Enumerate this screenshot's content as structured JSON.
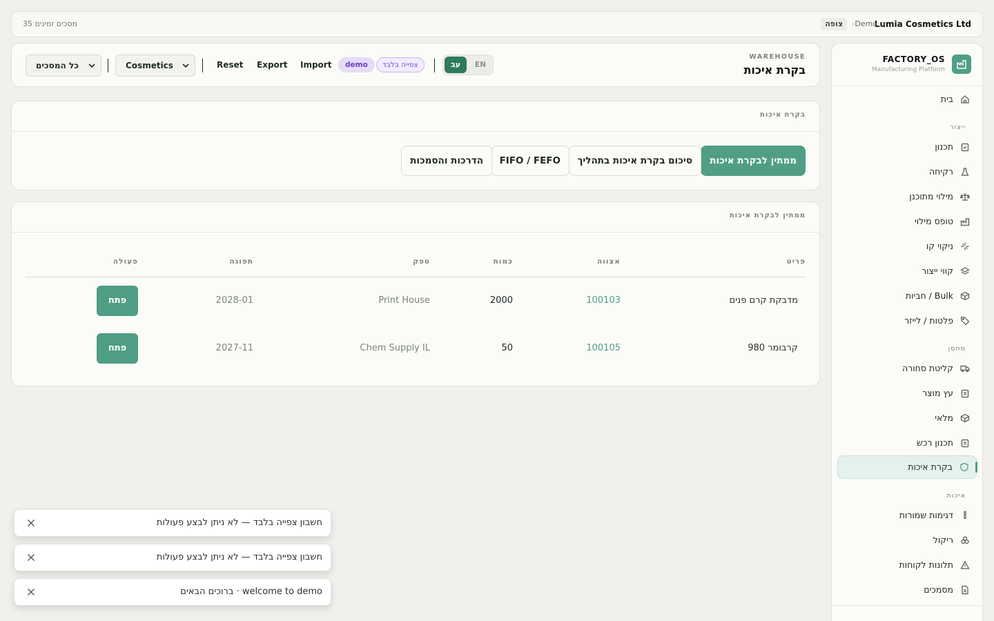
{
  "topbar": {
    "company": "Lumia Cosmetics Ltd",
    "demo": "Demo",
    "mode_badge": "צופה",
    "sessions": "35 מסכים זמינים"
  },
  "sidebar": {
    "brand_title": "FACTORY_OS",
    "brand_subtitle": "Manufacturing Platform",
    "home": "בית",
    "sections": {
      "production": "ייצור",
      "warehouse": "מחסן",
      "quality": "איכות"
    },
    "production_items": [
      "תכנון",
      "רקיחה",
      "מילוי מתוכנן",
      "טופס מילוי",
      "ניקוי קו",
      "קווי ייצור",
      "Bulk / חביות",
      "פלטות / לייזר"
    ],
    "warehouse_items": [
      "קליטת סחורה",
      "עץ מוצר",
      "מלאי",
      "תכנון רכש",
      "בקרת איכות"
    ],
    "quality_items": [
      "דגימות שמורות",
      "ריקול",
      "תלונות לקוחות",
      "מסמכים"
    ]
  },
  "header": {
    "kicker": "WAREHOUSE",
    "title": "בקרת איכות",
    "lang_en": "EN",
    "lang_he": "עב",
    "view_only": "צפייה בלבד",
    "demo": "demo",
    "import": "Import",
    "export": "Export",
    "reset": "Reset",
    "category_select": "Cosmetics",
    "docs_select": "כל המסכים"
  },
  "tabs_card": {
    "kicker": "בקרת איכות",
    "tabs": [
      "ממתין לבקרת איכות",
      "סיכום בקרת איכות בתהליך",
      "FIFO / FEFO",
      "הדרכות והסמכות"
    ]
  },
  "table_card": {
    "kicker": "ממתין לבקרת איכות",
    "columns": [
      "פריט",
      "אצווה",
      "כמות",
      "ספק",
      "תפוגה",
      "פעולה"
    ],
    "rows": [
      {
        "item": "מדבקת קרם פנים",
        "batch": "100103",
        "qty": "2000",
        "supplier": "Print House",
        "expiry": "2028-01",
        "action": "פתח"
      },
      {
        "item": "קרבומר 980",
        "batch": "100105",
        "qty": "50",
        "supplier": "Chem Supply IL",
        "expiry": "2027-11",
        "action": "פתח"
      }
    ]
  },
  "toasts": [
    "חשבון צפייה בלבד — לא ניתן לבצע פעולות",
    "חשבון צפייה בלבד — לא ניתן לבצע פעולות",
    "welcome to demo · ברוכים הבאים"
  ],
  "colors": {
    "accent": "#4f9e85",
    "accent_dark": "#2f7a5b",
    "purple": "#7a49d6",
    "background": "#f1f0ec"
  }
}
